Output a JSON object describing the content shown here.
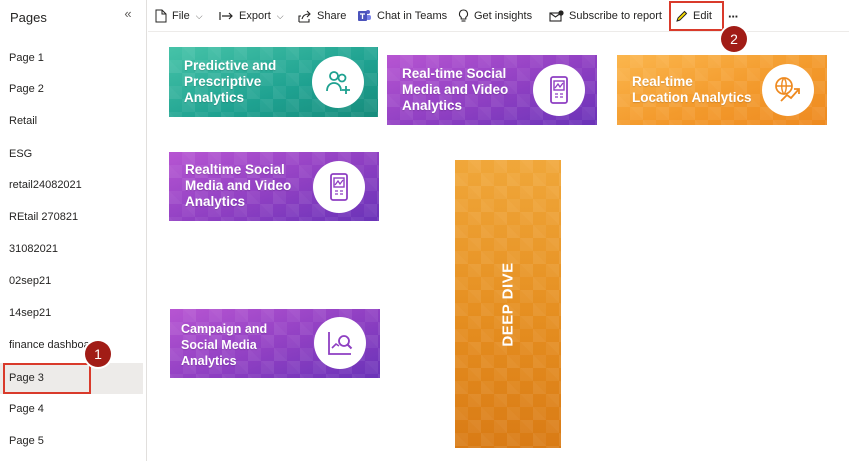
{
  "sidebar": {
    "title": "Pages",
    "collapse_icon": "double-chevron-left-icon",
    "pages": [
      {
        "label": "Page 1"
      },
      {
        "label": "Page 2"
      },
      {
        "label": "Retail"
      },
      {
        "label": "ESG"
      },
      {
        "label": "retail24082021"
      },
      {
        "label": "REtail 270821"
      },
      {
        "label": "31082021"
      },
      {
        "label": "02sep21"
      },
      {
        "label": "14sep21"
      },
      {
        "label": "finance dashboard"
      },
      {
        "label": "Page 3",
        "selected": true
      },
      {
        "label": "Page 4"
      },
      {
        "label": "Page 5"
      }
    ]
  },
  "toolbar": {
    "file": "File",
    "export": "Export",
    "share": "Share",
    "chat": "Chat in Teams",
    "insights": "Get insights",
    "subscribe": "Subscribe to report",
    "edit": "Edit",
    "more": "···"
  },
  "annotations": {
    "badge1": "1",
    "badge2": "2",
    "color": "#d93a2b"
  },
  "tiles": {
    "predictive": {
      "line1": "Predictive and",
      "line2": "Prescriptive",
      "line3": "Analytics",
      "icon": "users-add-icon"
    },
    "social1": {
      "line1": "Real-time Social",
      "line2": "Media and Video",
      "line3": "Analytics",
      "icon": "tablet-chart-icon"
    },
    "location": {
      "line1": "Real-time",
      "line2": "Location Analytics",
      "icon": "globe-trend-icon"
    },
    "social2": {
      "line1": "Realtime Social",
      "line2": "Media and Video",
      "line3": "Analytics",
      "icon": "tablet-chart-icon"
    },
    "campaign": {
      "line1": "Campaign and",
      "line2": "Social Media",
      "line3": "Analytics",
      "icon": "chart-search-icon"
    },
    "deep": {
      "label": "DEEP DIVE"
    }
  },
  "colors": {
    "teal": "#1ea190",
    "purple": "#8e3fc2",
    "orange": "#f39a2c"
  }
}
